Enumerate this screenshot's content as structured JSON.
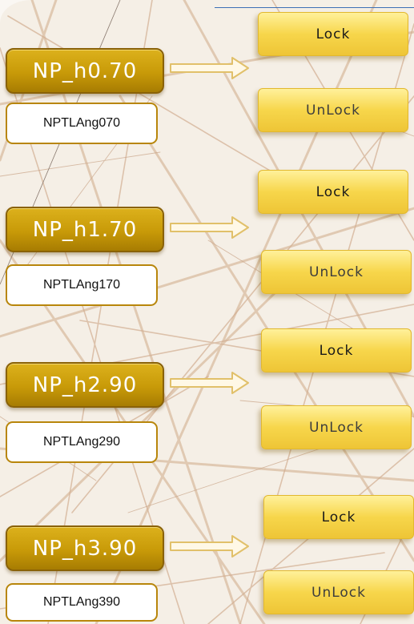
{
  "groups": [
    {
      "np_label": "NP_h0.70",
      "ang_label": "NPTLAng070",
      "lock_label": "Lock",
      "unlock_label": "UnLock"
    },
    {
      "np_label": "NP_h1.70",
      "ang_label": "NPTLAng170",
      "lock_label": "Lock",
      "unlock_label": "UnLock"
    },
    {
      "np_label": "NP_h2.90",
      "ang_label": "NPTLAng290",
      "lock_label": "Lock",
      "unlock_label": "UnLock"
    },
    {
      "np_label": "NP_h3.90",
      "ang_label": "NPTLAng390",
      "lock_label": "Lock",
      "unlock_label": "UnLock"
    }
  ],
  "colors": {
    "label_gold": "#c89a08",
    "button_gold": "#f7d64b",
    "arrow_outline": "#e1c06a",
    "accent_line": "#3c6fb6"
  }
}
